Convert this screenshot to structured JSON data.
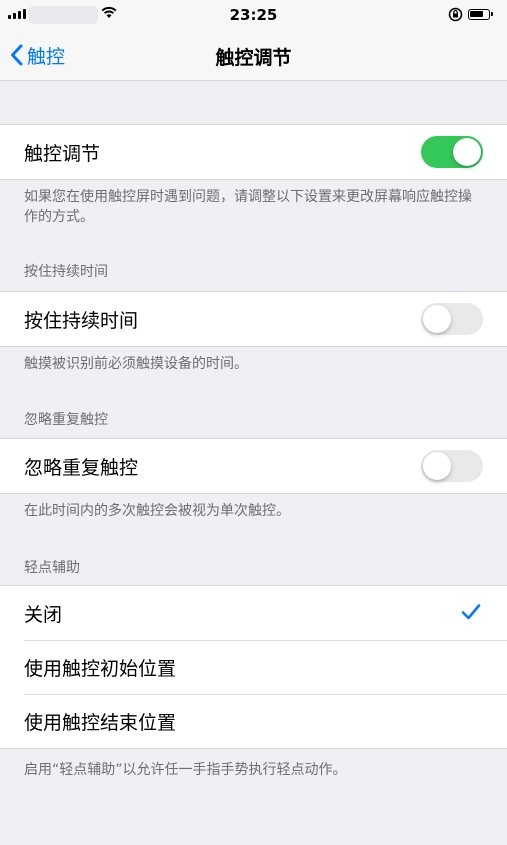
{
  "status_bar": {
    "time": "23:25"
  },
  "nav": {
    "back_label": "触控",
    "title": "触控调节"
  },
  "touch_accommodations": {
    "label": "触控调节",
    "enabled": true,
    "footer": "如果您在使用触控屏时遇到问题，请调整以下设置来更改屏幕响应触控操作的方式。"
  },
  "hold_duration": {
    "header": "按住持续时间",
    "label": "按住持续时间",
    "enabled": false,
    "footer": "触摸被识别前必须触摸设备的时间。"
  },
  "ignore_repeat": {
    "header": "忽略重复触控",
    "label": "忽略重复触控",
    "enabled": false,
    "footer": "在此时间内的多次触控会被视为单次触控。"
  },
  "tap_assistance": {
    "header": "轻点辅助",
    "options": [
      {
        "label": "关闭",
        "selected": true
      },
      {
        "label": "使用触控初始位置",
        "selected": false
      },
      {
        "label": "使用触控结束位置",
        "selected": false
      }
    ],
    "footer": "启用“轻点辅助”以允许任一手指手势执行轻点动作。"
  },
  "colors": {
    "accent": "#007aff",
    "toggle_on": "#34c759",
    "toggle_off": "#e9e9eb",
    "background": "#efeff4"
  }
}
